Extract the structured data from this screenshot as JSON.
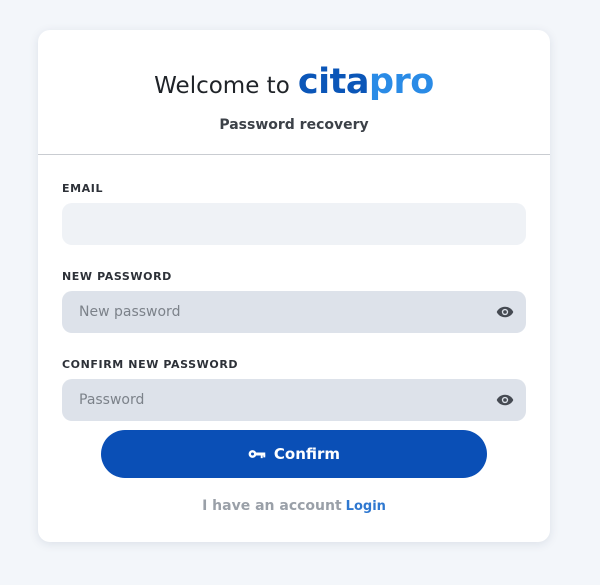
{
  "header": {
    "welcome": "Welcome to",
    "brand_part1": "cita",
    "brand_part2": "pro",
    "subtitle": "Password recovery"
  },
  "form": {
    "email": {
      "label": "EMAIL",
      "value": "",
      "placeholder": ""
    },
    "new_password": {
      "label": "NEW PASSWORD",
      "placeholder": "New password",
      "toggle_icon": "eye-icon"
    },
    "confirm_password": {
      "label": "CONFIRM NEW PASSWORD",
      "placeholder": "Password",
      "toggle_icon": "eye-icon"
    },
    "submit": {
      "label": "Confirm",
      "icon": "key-icon"
    }
  },
  "footer": {
    "text": "I have an account",
    "link": "Login"
  },
  "colors": {
    "brand_dark": "#0b56b8",
    "brand_light": "#2a8be6",
    "button": "#0a4fb6",
    "link": "#2f78d0",
    "page_bg": "#f3f6fa"
  }
}
